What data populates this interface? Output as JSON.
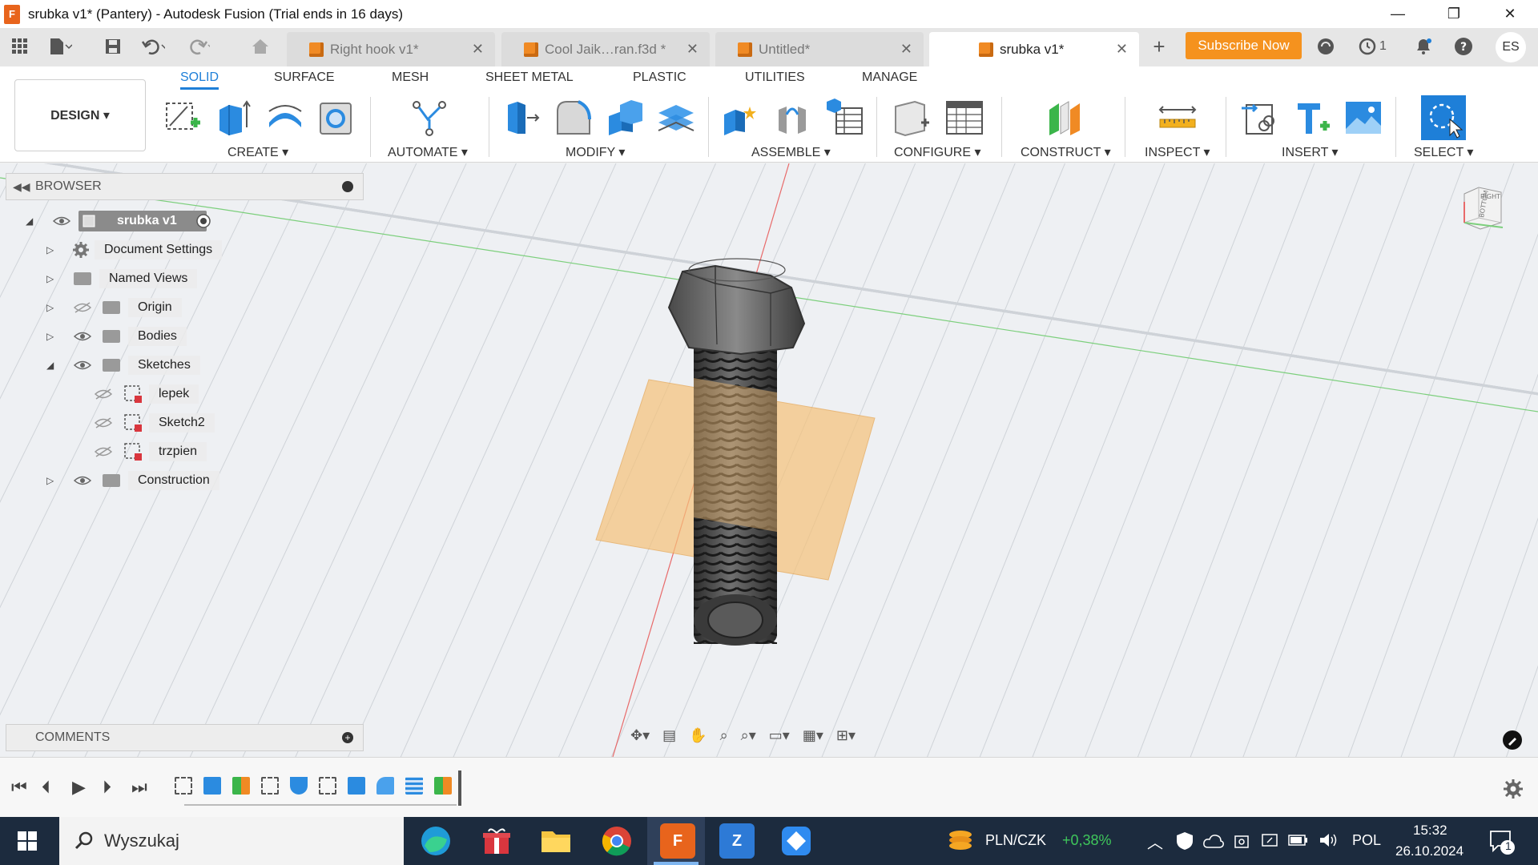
{
  "window": {
    "app_icon": "F",
    "title": "srubka v1* (Pantery) - Autodesk Fusion (Trial ends in 16 days)",
    "controls": [
      "—",
      "❐",
      "✕"
    ]
  },
  "doc_tabs": [
    {
      "label": "Right hook v1*",
      "active": false
    },
    {
      "label": "Cool Jaik…ran.f3d *",
      "active": false
    },
    {
      "label": "Untitled*",
      "active": false
    },
    {
      "label": "srubka v1*",
      "active": true
    }
  ],
  "tabbar": {
    "subscribe_label": "Subscribe Now",
    "jobs_count": "1",
    "avatar_initials": "ES"
  },
  "toolbar": {
    "design_label": "DESIGN ▾",
    "workspace_tabs": [
      "SOLID",
      "SURFACE",
      "MESH",
      "SHEET METAL",
      "PLASTIC",
      "UTILITIES",
      "MANAGE"
    ],
    "active_tab": "SOLID",
    "groups": [
      {
        "label": "CREATE ▾"
      },
      {
        "label": "AUTOMATE ▾"
      },
      {
        "label": "MODIFY ▾"
      },
      {
        "label": "ASSEMBLE ▾"
      },
      {
        "label": "CONFIGURE ▾"
      },
      {
        "label": "CONSTRUCT ▾"
      },
      {
        "label": "INSPECT ▾"
      },
      {
        "label": "INSERT ▾"
      },
      {
        "label": "SELECT ▾"
      }
    ]
  },
  "browser": {
    "title": "BROWSER",
    "root": "srubka v1",
    "items": [
      {
        "label": "Document Settings"
      },
      {
        "label": "Named Views"
      },
      {
        "label": "Origin"
      },
      {
        "label": "Bodies"
      },
      {
        "label": "Sketches"
      },
      {
        "label": "lepek"
      },
      {
        "label": "Sketch2"
      },
      {
        "label": "trzpien"
      },
      {
        "label": "Construction"
      }
    ]
  },
  "comments": {
    "title": "COMMENTS"
  },
  "viewcube": {
    "face_top": "RIGHT",
    "face_front": "BOTTOM"
  },
  "taskbar": {
    "search_label": "Wyszukaj",
    "fusion_label": "F",
    "z_label": "Z",
    "ticker_label": "PLN/CZK",
    "ticker_value": "+0,38%",
    "language": "POL",
    "time": "15:32",
    "date": "26.10.2024",
    "notif_count": "1"
  },
  "colors": {
    "accent_blue": "#1e7fd8",
    "subscribe_orange": "#f5921e",
    "sketch_plane": "#f6c27a",
    "taskbar_bg": "#1c2b3e",
    "ticker_green": "#3fc75b"
  }
}
